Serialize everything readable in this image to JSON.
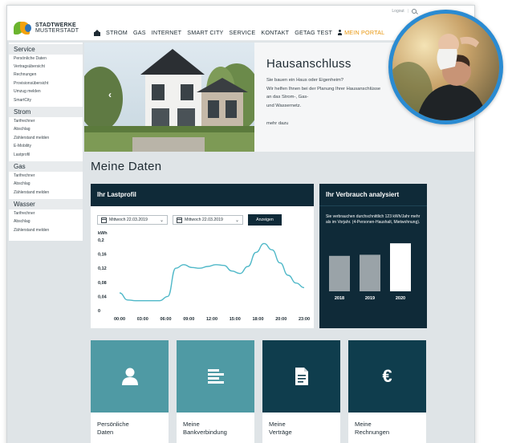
{
  "utility": {
    "logout": "Logout",
    "separator": "|"
  },
  "logo": {
    "line1": "STADTWERKE",
    "line2": "MUSTERSTADT"
  },
  "nav": {
    "items": [
      "STROM",
      "GAS",
      "INTERNET",
      "SMART CITY",
      "SERVICE",
      "KONTAKT",
      "GETAG TEST"
    ],
    "portal": "MEIN PORTAL"
  },
  "sidebar": {
    "groups": [
      {
        "title": "Service",
        "items": [
          "Persönliche Daten",
          "Vertragsübersicht",
          "Rechnungen",
          "Provisionsübersicht",
          "Umzug melden",
          "SmartCity"
        ]
      },
      {
        "title": "Strom",
        "items": [
          "Tarifrechner",
          "Abschlag",
          "Zählerstand melden",
          "E-Mobility",
          "Lastprofil"
        ]
      },
      {
        "title": "Gas",
        "items": [
          "Tarifrechner",
          "Abschlag",
          "Zählerstand melden"
        ]
      },
      {
        "title": "Wasser",
        "items": [
          "Tarifrechner",
          "Abschlag",
          "Zählerstand melden"
        ]
      }
    ]
  },
  "hero": {
    "title": "Hausanschluss",
    "lines": [
      "Sie bauen ein Haus oder Eigenheim?",
      "Wir helfen Ihnen bei der Planung Ihrer Hausanschlüsse",
      "an das Strom-, Gas-",
      "und Wassernetz."
    ],
    "more": "mehr dazu",
    "prev_arrow": "‹"
  },
  "section_title": "Meine Daten",
  "lastprofil": {
    "title": "Ihr Lastprofil",
    "date_from": "Mittwoch 22.03.2019",
    "date_to": "Mittwoch 22.03.2019",
    "button": "Anzeigen"
  },
  "verbrauch": {
    "title": "Ihr Verbrauch analysiert",
    "text": "Sie verbrauchen durchschnittlich 123 kWh/Jahr mehr als im Vorjahr. (4-Personen-Haushalt, Mietwohnung)."
  },
  "chart_data": [
    {
      "type": "line",
      "title": "Ihr Lastprofil",
      "ylabel": "kWh",
      "ylim": [
        0,
        0.2
      ],
      "yticks": [
        "0,2",
        "0,16",
        "0,12",
        "0,08",
        "0,04",
        "0"
      ],
      "xticks": [
        "00:00",
        "03:00",
        "06:00",
        "09:00",
        "12:00",
        "15:00",
        "18:00",
        "20:00",
        "23:00"
      ],
      "x": [
        0,
        1,
        2,
        3,
        4,
        5,
        6,
        7,
        8,
        9,
        10,
        11,
        12,
        13,
        14,
        15,
        16,
        17,
        18,
        19,
        20,
        21,
        22,
        23
      ],
      "values": [
        0.05,
        0.03,
        0.028,
        0.028,
        0.028,
        0.028,
        0.04,
        0.12,
        0.13,
        0.122,
        0.12,
        0.125,
        0.13,
        0.128,
        0.112,
        0.105,
        0.125,
        0.165,
        0.19,
        0.172,
        0.135,
        0.1,
        0.078,
        0.065
      ],
      "color": "#4fb8c8"
    },
    {
      "type": "bar",
      "categories": [
        "2018",
        "2019",
        "2020"
      ],
      "values": [
        0.65,
        0.67,
        0.88
      ],
      "ylim": [
        0,
        1
      ],
      "colors": [
        "#9aa3a8",
        "#9aa3a8",
        "#ffffff"
      ]
    }
  ],
  "tiles": [
    {
      "line1": "Persönliche",
      "line2": "Daten",
      "icon": "person-icon"
    },
    {
      "line1": "Meine",
      "line2": "Bankverbindung",
      "icon": "bank-lines-icon"
    },
    {
      "line1": "Meine",
      "line2": "Verträge",
      "icon": "document-icon"
    },
    {
      "line1": "Meine",
      "line2": "Rechnungen",
      "icon": "euro-icon",
      "symbol": "€"
    }
  ],
  "colors": {
    "accent": "#e8960c",
    "navy": "#0f2a38",
    "teal": "#4f9aa4",
    "dark_teal": "#0f3d4d",
    "ring": "#2a8bd2"
  }
}
